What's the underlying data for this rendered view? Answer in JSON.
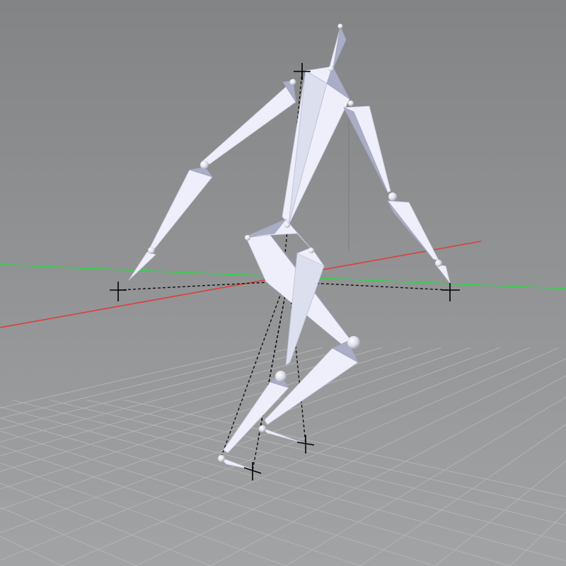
{
  "viewport": {
    "background_top": "#838485",
    "background_bottom": "#a2a3a5",
    "grid_color": "#b7b7b7"
  },
  "axes": {
    "x_axis_color": "#d9413c",
    "z_axis_color": "#2fd44a",
    "y_axis_color": "#7f7f7f"
  },
  "rig": {
    "bone_color": "#e7e8f6",
    "bone_shade": "#a9adc6",
    "joint_color": "#e9eaf2",
    "ik_line_color": "#111111",
    "ik_target_icon": "crosshair-icon"
  }
}
